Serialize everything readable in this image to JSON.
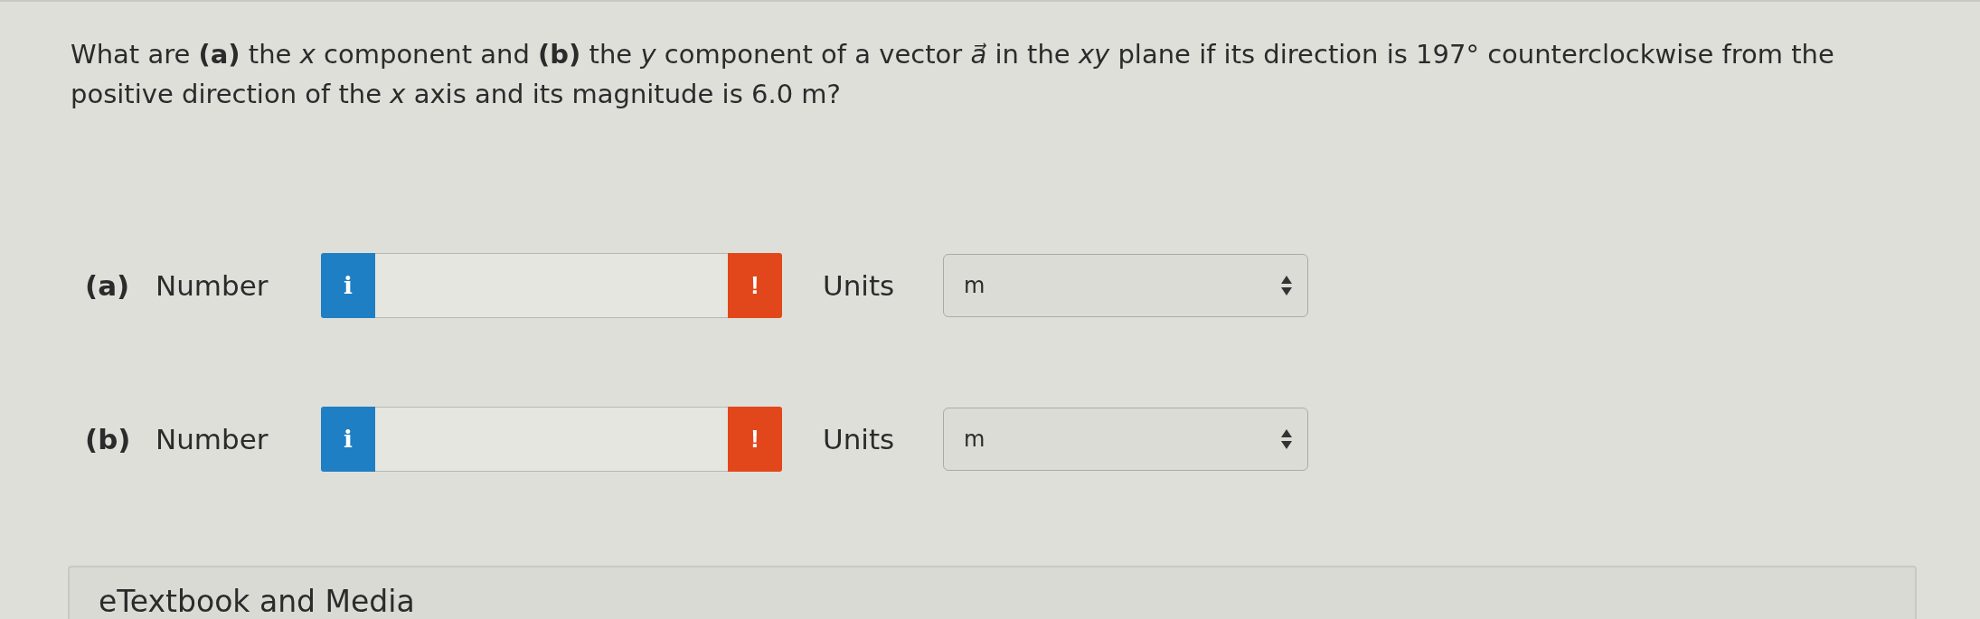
{
  "question": "What are **(a)** the *x* component and **(b)** the *y* component of a vector *a⃗* in the *xy* plane if its direction is 197° counterclockwise from the positive direction of the *x* axis and its magnitude is 6.0 m?",
  "parts": [
    {
      "label": "(a)",
      "number_label": "Number",
      "info": "i",
      "alert": "!",
      "units_label": "Units",
      "units_value": "m"
    },
    {
      "label": "(b)",
      "number_label": "Number",
      "info": "i",
      "alert": "!",
      "units_label": "Units",
      "units_value": "m"
    }
  ],
  "media_panel": {
    "title": "eTextbook and Media"
  }
}
